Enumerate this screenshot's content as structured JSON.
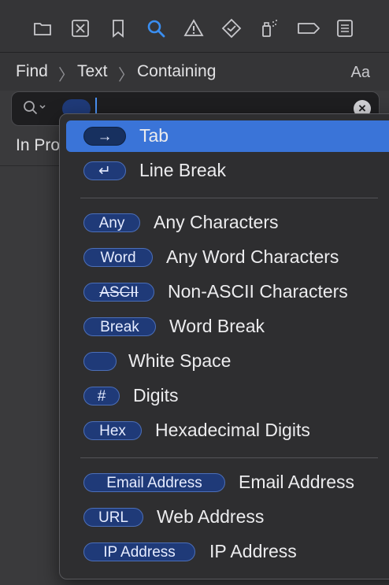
{
  "toolbar": {
    "icons": [
      "folder-icon",
      "close-square-icon",
      "bookmark-icon",
      "search-icon",
      "warning-icon",
      "diamond-check-icon",
      "spray-icon",
      "tag-icon",
      "list-icon"
    ],
    "active_icon": "search-icon",
    "accent": "#3a8ef0"
  },
  "breadcrumb": {
    "items": [
      "Find",
      "Text",
      "Containing"
    ],
    "case_toggle": "Aa"
  },
  "search": {
    "value": "",
    "clear_symbol": "×"
  },
  "scope_label": "In Pro",
  "menu": {
    "items": [
      {
        "token": "→",
        "label": "Tab",
        "selected": true
      },
      {
        "token": "↵",
        "label": "Line Break"
      },
      {
        "token": "Any",
        "label": "Any Characters"
      },
      {
        "token": "Word",
        "label": "Any Word Characters"
      },
      {
        "token": "ASCII",
        "label": "Non-ASCII Characters"
      },
      {
        "token": "Break",
        "label": "Word Break"
      },
      {
        "token": "",
        "label": "White Space"
      },
      {
        "token": "#",
        "label": "Digits"
      },
      {
        "token": "Hex",
        "label": "Hexadecimal Digits"
      },
      {
        "token": "Email Address",
        "label": "Email Address"
      },
      {
        "token": "URL",
        "label": "Web Address"
      },
      {
        "token": "IP Address",
        "label": "IP Address"
      }
    ]
  }
}
